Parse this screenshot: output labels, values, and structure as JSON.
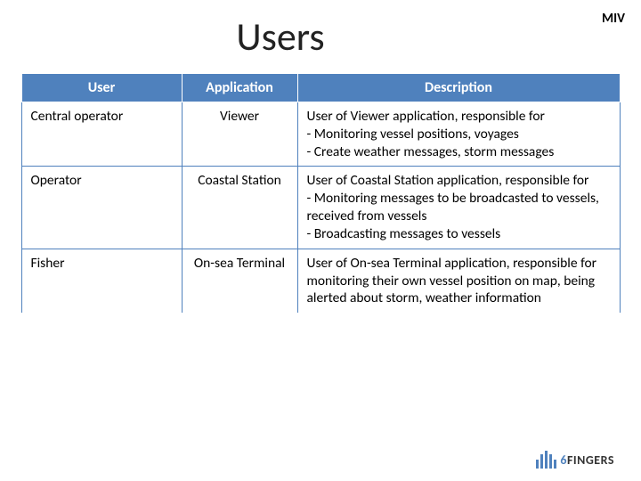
{
  "header": {
    "corner_label": "MIV",
    "title": "Users"
  },
  "table": {
    "columns": [
      "User",
      "Application",
      "Description"
    ],
    "rows": [
      {
        "user": "Central operator",
        "application": "Viewer",
        "description": "User of Viewer application, responsible for\n- Monitoring vessel positions, voyages\n- Create weather messages, storm messages"
      },
      {
        "user": "Operator",
        "application": "Coastal Station",
        "description": "User of Coastal Station application, responsible for\n- Monitoring messages to be broadcasted to vessels, received from vessels\n- Broadcasting messages to vessels"
      },
      {
        "user": "Fisher",
        "application": "On-sea Terminal",
        "description": "User of On-sea Terminal application, responsible for monitoring their own vessel position on map, being alerted about storm, weather information"
      }
    ]
  },
  "footer": {
    "logo_prefix": "6",
    "logo_text": "FINGERS"
  }
}
